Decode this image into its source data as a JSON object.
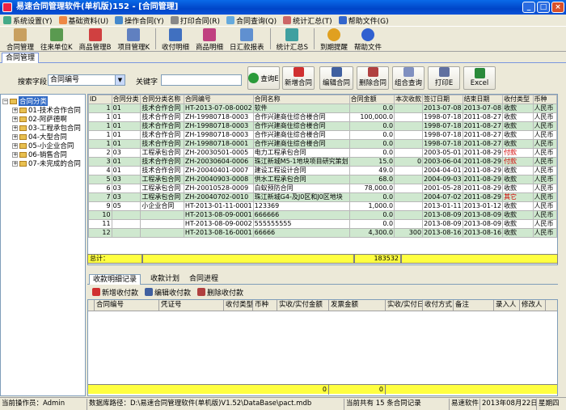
{
  "window": {
    "title": "易速合同管理软件(单机版)152 - [合同管理]"
  },
  "menu": [
    "系统设置(Y)",
    "基础资料(U)",
    "操作合同(Y)",
    "打印合同(R)",
    "合同查询(Q)",
    "统计汇总(T)",
    "帮助文件(G)"
  ],
  "toolbar": [
    "合同管理",
    "往来单位K",
    "商品管理B",
    "项目管理K",
    "收付明细",
    "商品明细",
    "日汇款报表",
    "统计汇总S",
    "到期提醒",
    "帮助文件"
  ],
  "doc_tab": "合同管理",
  "search": {
    "field_label": "搜索字段",
    "field_value": "合同编号",
    "keyword_label": "关键字",
    "keyword_value": ""
  },
  "buttons": [
    "查询E",
    "新增合同",
    "编辑合同",
    "删除合同",
    "组合查询",
    "打印E",
    "Excel"
  ],
  "tree": {
    "root": "合同分类",
    "items": [
      "01-技术合作合同",
      "02-阿萨德啊",
      "03-工程承包合同",
      "04-大型合同",
      "05-小企业合同",
      "06-销售合同",
      "07-未完成的合同"
    ]
  },
  "grid": {
    "headers": [
      "ID",
      "合同分类",
      "合同分类名称",
      "合同编号",
      "合同名称",
      "合同金额",
      "本次收款",
      "签订日期",
      "结束日期",
      "收付类型",
      "币种"
    ],
    "rows": [
      [
        "1",
        "01",
        "技术合作合同",
        "HT-2013-07-08-0002",
        "软件",
        "0.0",
        "",
        "2013-07-08",
        "2013-07-08",
        "收款",
        "人民币"
      ],
      [
        "1",
        "01",
        "技术合作合同",
        "ZH-19980718-0003",
        "合作兴建商住综合楼合同",
        "100,000.0",
        "",
        "1998-07-18",
        "2011-08-27",
        "收款",
        "人民币"
      ],
      [
        "1",
        "01",
        "技术合作合同",
        "ZH-19980718-0003",
        "合作兴建商住综合楼合同",
        "0.0",
        "",
        "1998-07-18",
        "2011-08-27",
        "收款",
        "人民币"
      ],
      [
        "1",
        "01",
        "技术合作合同",
        "ZH-19980718-0003",
        "合作兴建商住综合楼合同",
        "0.0",
        "",
        "1998-07-18",
        "2011-08-27",
        "收款",
        "人民币"
      ],
      [
        "1",
        "01",
        "技术合作合同",
        "ZH-19980718-0001",
        "合作兴建商住综合楼合同",
        "0.0",
        "",
        "1998-07-18",
        "2011-08-27",
        "收款",
        "人民币"
      ],
      [
        "2",
        "03",
        "工程承包合同",
        "ZH-20030501-0005",
        "电力工程承包合同",
        "0.0",
        "",
        "2003-05-01",
        "2011-08-29",
        "付款",
        "人民币"
      ],
      [
        "3",
        "01",
        "技术合作合同",
        "ZH-20030604-0006",
        "珠江新城M5-1地块项目研究策划",
        "15.0",
        "0",
        "2003-06-04",
        "2011-08-29",
        "付款",
        "人民币"
      ],
      [
        "4",
        "01",
        "技术合作合同",
        "ZH-20040401-0007",
        "建设工程设计合同",
        "49.0",
        "",
        "2004-04-01",
        "2011-08-29",
        "收款",
        "人民币"
      ],
      [
        "5",
        "03",
        "工程承包合同",
        "ZH-20040903-0008",
        "供水工程承包合同",
        "68.0",
        "",
        "2004-09-03",
        "2011-08-29",
        "收款",
        "人民币"
      ],
      [
        "6",
        "03",
        "工程承包合同",
        "ZH-20010528-0009",
        "白蚁预防合同",
        "78,000.0",
        "",
        "2001-05-28",
        "2011-08-29",
        "收款",
        "人民币"
      ],
      [
        "7",
        "03",
        "工程承包合同",
        "ZH-20040702-0010",
        "珠江新城G4-及J0区和J0区地块",
        "0.0",
        "",
        "2004-07-02",
        "2011-08-29",
        "其它",
        "人民币"
      ],
      [
        "9",
        "05",
        "小企业合同",
        "HT-2013-01-11-0001",
        "123369",
        "1,000.0",
        "",
        "2013-01-11",
        "2013-01-12",
        "收款",
        "人民币"
      ],
      [
        "10",
        "",
        "",
        "HT-2013-08-09-0001",
        "666666",
        "0.0",
        "",
        "2013-08-09",
        "2013-08-09",
        "收款",
        "人民币"
      ],
      [
        "11",
        "",
        "",
        "HT-2013-08-09-0002",
        "555555555",
        "0.0",
        "",
        "2013-08-09",
        "2013-08-09",
        "收款",
        "人民币"
      ],
      [
        "12",
        "",
        "",
        "HT-2013-08-16-0001",
        "66666",
        "4,300.0",
        "300",
        "2013-08-16",
        "2013-08-16",
        "收款",
        "人民币"
      ]
    ],
    "total_label": "总计：",
    "total_amount": "183532"
  },
  "subtabs": [
    "收款明细记录",
    "收款计划",
    "合同进程"
  ],
  "subtoolbar": [
    "新增收付款",
    "编辑收付款",
    "删除收付款"
  ],
  "grid2": {
    "headers": [
      "合同编号",
      "凭证号",
      "收付类型",
      "币种",
      "实收/实付金额",
      "发票金额",
      "实收/实付日",
      "收付方式",
      "备注",
      "录入人",
      "修改人"
    ],
    "sum_values": [
      "0",
      "0"
    ]
  },
  "status": {
    "operator": "当前操作员：Admin",
    "dbpath": "数据库路径：D:\\易速合同管理软件(单机版)V1.52\\DataBase\\pact.mdb",
    "count": "当前共有 15 条合同记录",
    "brand": "易速软件",
    "date": "2013年08月22日",
    "weekday": "星期四"
  },
  "red_values": [
    "付款",
    "其它"
  ]
}
